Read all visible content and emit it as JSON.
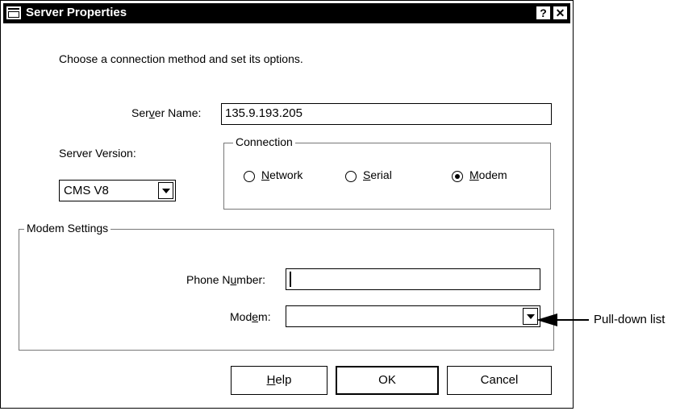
{
  "dialog": {
    "title": "Server Properties",
    "help_button": "?",
    "close_button": "✕",
    "intro": "Choose a connection method and set its options."
  },
  "server": {
    "name_label_pre": "Ser",
    "name_label_ul": "v",
    "name_label_post": "er Name:",
    "name_value": "135.9.193.205",
    "version_label": "Server Version:",
    "version_value": "CMS V8"
  },
  "connection": {
    "legend": "Connection",
    "options": [
      {
        "ul": "N",
        "rest": "etwork",
        "selected": false
      },
      {
        "ul": "S",
        "rest": "erial",
        "selected": false
      },
      {
        "ul": "M",
        "rest": "odem",
        "selected": true
      }
    ]
  },
  "modem_settings": {
    "legend": "Modem Settings",
    "phone_label_pre": "Phone N",
    "phone_label_ul": "u",
    "phone_label_post": "mber:",
    "phone_value": "",
    "modem_label_pre": "Mod",
    "modem_label_ul": "e",
    "modem_label_post": "m:",
    "modem_value": ""
  },
  "buttons": {
    "help_ul": "H",
    "help_rest": "elp",
    "ok": "OK",
    "cancel": "Cancel"
  },
  "annotation": {
    "text": "Pull-down list"
  }
}
